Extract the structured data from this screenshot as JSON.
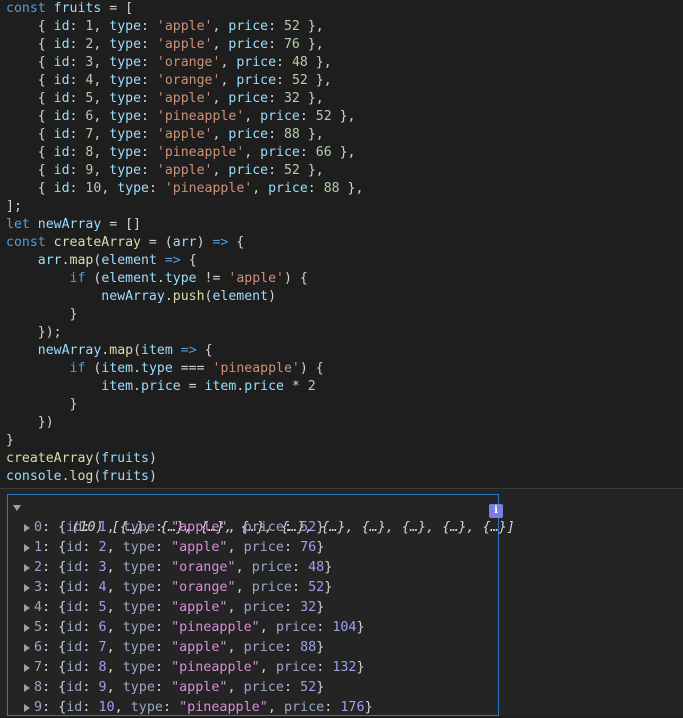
{
  "code": [
    [
      [
        "kw",
        "const "
      ],
      [
        "vr",
        "fruits"
      ],
      [
        "pl",
        " = ["
      ]
    ],
    [
      [
        "pl",
        "    { "
      ],
      [
        "vr",
        "id"
      ],
      [
        "pl",
        ": "
      ],
      [
        "nm",
        "1"
      ],
      [
        "pl",
        ", "
      ],
      [
        "vr",
        "type"
      ],
      [
        "pl",
        ": "
      ],
      [
        "st",
        "'apple'"
      ],
      [
        "pl",
        ", "
      ],
      [
        "vr",
        "price"
      ],
      [
        "pl",
        ": "
      ],
      [
        "nm",
        "52"
      ],
      [
        "pl",
        " },"
      ]
    ],
    [
      [
        "pl",
        "    { "
      ],
      [
        "vr",
        "id"
      ],
      [
        "pl",
        ": "
      ],
      [
        "nm",
        "2"
      ],
      [
        "pl",
        ", "
      ],
      [
        "vr",
        "type"
      ],
      [
        "pl",
        ": "
      ],
      [
        "st",
        "'apple'"
      ],
      [
        "pl",
        ", "
      ],
      [
        "vr",
        "price"
      ],
      [
        "pl",
        ": "
      ],
      [
        "nm",
        "76"
      ],
      [
        "pl",
        " },"
      ]
    ],
    [
      [
        "pl",
        "    { "
      ],
      [
        "vr",
        "id"
      ],
      [
        "pl",
        ": "
      ],
      [
        "nm",
        "3"
      ],
      [
        "pl",
        ", "
      ],
      [
        "vr",
        "type"
      ],
      [
        "pl",
        ": "
      ],
      [
        "st",
        "'orange'"
      ],
      [
        "pl",
        ", "
      ],
      [
        "vr",
        "price"
      ],
      [
        "pl",
        ": "
      ],
      [
        "nm",
        "48"
      ],
      [
        "pl",
        " },"
      ]
    ],
    [
      [
        "pl",
        "    { "
      ],
      [
        "vr",
        "id"
      ],
      [
        "pl",
        ": "
      ],
      [
        "nm",
        "4"
      ],
      [
        "pl",
        ", "
      ],
      [
        "vr",
        "type"
      ],
      [
        "pl",
        ": "
      ],
      [
        "st",
        "'orange'"
      ],
      [
        "pl",
        ", "
      ],
      [
        "vr",
        "price"
      ],
      [
        "pl",
        ": "
      ],
      [
        "nm",
        "52"
      ],
      [
        "pl",
        " },"
      ]
    ],
    [
      [
        "pl",
        "    { "
      ],
      [
        "vr",
        "id"
      ],
      [
        "pl",
        ": "
      ],
      [
        "nm",
        "5"
      ],
      [
        "pl",
        ", "
      ],
      [
        "vr",
        "type"
      ],
      [
        "pl",
        ": "
      ],
      [
        "st",
        "'apple'"
      ],
      [
        "pl",
        ", "
      ],
      [
        "vr",
        "price"
      ],
      [
        "pl",
        ": "
      ],
      [
        "nm",
        "32"
      ],
      [
        "pl",
        " },"
      ]
    ],
    [
      [
        "pl",
        "    { "
      ],
      [
        "vr",
        "id"
      ],
      [
        "pl",
        ": "
      ],
      [
        "nm",
        "6"
      ],
      [
        "pl",
        ", "
      ],
      [
        "vr",
        "type"
      ],
      [
        "pl",
        ": "
      ],
      [
        "st",
        "'pineapple'"
      ],
      [
        "pl",
        ", "
      ],
      [
        "vr",
        "price"
      ],
      [
        "pl",
        ": "
      ],
      [
        "nm",
        "52"
      ],
      [
        "pl",
        " },"
      ]
    ],
    [
      [
        "pl",
        "    { "
      ],
      [
        "vr",
        "id"
      ],
      [
        "pl",
        ": "
      ],
      [
        "nm",
        "7"
      ],
      [
        "pl",
        ", "
      ],
      [
        "vr",
        "type"
      ],
      [
        "pl",
        ": "
      ],
      [
        "st",
        "'apple'"
      ],
      [
        "pl",
        ", "
      ],
      [
        "vr",
        "price"
      ],
      [
        "pl",
        ": "
      ],
      [
        "nm",
        "88"
      ],
      [
        "pl",
        " },"
      ]
    ],
    [
      [
        "pl",
        "    { "
      ],
      [
        "vr",
        "id"
      ],
      [
        "pl",
        ": "
      ],
      [
        "nm",
        "8"
      ],
      [
        "pl",
        ", "
      ],
      [
        "vr",
        "type"
      ],
      [
        "pl",
        ": "
      ],
      [
        "st",
        "'pineapple'"
      ],
      [
        "pl",
        ", "
      ],
      [
        "vr",
        "price"
      ],
      [
        "pl",
        ": "
      ],
      [
        "nm",
        "66"
      ],
      [
        "pl",
        " },"
      ]
    ],
    [
      [
        "pl",
        "    { "
      ],
      [
        "vr",
        "id"
      ],
      [
        "pl",
        ": "
      ],
      [
        "nm",
        "9"
      ],
      [
        "pl",
        ", "
      ],
      [
        "vr",
        "type"
      ],
      [
        "pl",
        ": "
      ],
      [
        "st",
        "'apple'"
      ],
      [
        "pl",
        ", "
      ],
      [
        "vr",
        "price"
      ],
      [
        "pl",
        ": "
      ],
      [
        "nm",
        "52"
      ],
      [
        "pl",
        " },"
      ]
    ],
    [
      [
        "pl",
        "    { "
      ],
      [
        "vr",
        "id"
      ],
      [
        "pl",
        ": "
      ],
      [
        "nm",
        "10"
      ],
      [
        "pl",
        ", "
      ],
      [
        "vr",
        "type"
      ],
      [
        "pl",
        ": "
      ],
      [
        "st",
        "'pineapple'"
      ],
      [
        "pl",
        ", "
      ],
      [
        "vr",
        "price"
      ],
      [
        "pl",
        ": "
      ],
      [
        "nm",
        "88"
      ],
      [
        "pl",
        " },"
      ]
    ],
    [
      [
        "pl",
        "];"
      ]
    ],
    [
      [
        "kw",
        "let "
      ],
      [
        "vr",
        "newArray"
      ],
      [
        "pl",
        " = []"
      ]
    ],
    [
      [
        "kw",
        "const "
      ],
      [
        "fn",
        "createArray"
      ],
      [
        "pl",
        " = ("
      ],
      [
        "vr",
        "arr"
      ],
      [
        "pl",
        ") "
      ],
      [
        "kw",
        "=>"
      ],
      [
        "pl",
        " {"
      ]
    ],
    [
      [
        "pl",
        "    "
      ],
      [
        "vr",
        "arr"
      ],
      [
        "pl",
        "."
      ],
      [
        "fn",
        "map"
      ],
      [
        "pl",
        "("
      ],
      [
        "vr",
        "element"
      ],
      [
        "pl",
        " "
      ],
      [
        "kw",
        "=>"
      ],
      [
        "pl",
        " {"
      ]
    ],
    [
      [
        "pl",
        "        "
      ],
      [
        "kw",
        "if"
      ],
      [
        "pl",
        " ("
      ],
      [
        "vr",
        "element"
      ],
      [
        "pl",
        "."
      ],
      [
        "vr",
        "type"
      ],
      [
        "pl",
        " != "
      ],
      [
        "st",
        "'apple'"
      ],
      [
        "pl",
        ") {"
      ]
    ],
    [
      [
        "pl",
        "            "
      ],
      [
        "vr",
        "newArray"
      ],
      [
        "pl",
        "."
      ],
      [
        "fn",
        "push"
      ],
      [
        "pl",
        "("
      ],
      [
        "vr",
        "element"
      ],
      [
        "pl",
        ")"
      ]
    ],
    [
      [
        "pl",
        "        }"
      ]
    ],
    [
      [
        "pl",
        "    });"
      ]
    ],
    [
      [
        "pl",
        "    "
      ],
      [
        "vr",
        "newArray"
      ],
      [
        "pl",
        "."
      ],
      [
        "fn",
        "map"
      ],
      [
        "pl",
        "("
      ],
      [
        "vr",
        "item"
      ],
      [
        "pl",
        " "
      ],
      [
        "kw",
        "=>"
      ],
      [
        "pl",
        " {"
      ]
    ],
    [
      [
        "pl",
        "        "
      ],
      [
        "kw",
        "if"
      ],
      [
        "pl",
        " ("
      ],
      [
        "vr",
        "item"
      ],
      [
        "pl",
        "."
      ],
      [
        "vr",
        "type"
      ],
      [
        "pl",
        " === "
      ],
      [
        "st",
        "'pineapple'"
      ],
      [
        "pl",
        ") {"
      ]
    ],
    [
      [
        "pl",
        "            "
      ],
      [
        "vr",
        "item"
      ],
      [
        "pl",
        "."
      ],
      [
        "vr",
        "price"
      ],
      [
        "pl",
        " = "
      ],
      [
        "vr",
        "item"
      ],
      [
        "pl",
        "."
      ],
      [
        "vr",
        "price"
      ],
      [
        "pl",
        " * "
      ],
      [
        "nm",
        "2"
      ]
    ],
    [
      [
        "pl",
        "        }"
      ]
    ],
    [
      [
        "pl",
        "    })"
      ]
    ],
    [
      [
        "pl",
        "}"
      ]
    ],
    [
      [
        "fn",
        "createArray"
      ],
      [
        "pl",
        "("
      ],
      [
        "vr",
        "fruits"
      ],
      [
        "pl",
        ")"
      ]
    ],
    [
      [
        "vr",
        "console"
      ],
      [
        "pl",
        "."
      ],
      [
        "fn",
        "log"
      ],
      [
        "pl",
        "("
      ],
      [
        "vr",
        "fruits"
      ],
      [
        "pl",
        ")"
      ]
    ]
  ],
  "console": {
    "summary": "(10) [{…}, {…}, {…}, {…}, {…}, {…}, {…}, {…}, {…}, {…}]",
    "info_badge": "i",
    "entries": [
      {
        "index": "0",
        "id": "1",
        "type": "\"apple\"",
        "price": "52"
      },
      {
        "index": "1",
        "id": "2",
        "type": "\"apple\"",
        "price": "76"
      },
      {
        "index": "2",
        "id": "3",
        "type": "\"orange\"",
        "price": "48"
      },
      {
        "index": "3",
        "id": "4",
        "type": "\"orange\"",
        "price": "52"
      },
      {
        "index": "4",
        "id": "5",
        "type": "\"apple\"",
        "price": "32"
      },
      {
        "index": "5",
        "id": "6",
        "type": "\"pineapple\"",
        "price": "104"
      },
      {
        "index": "6",
        "id": "7",
        "type": "\"apple\"",
        "price": "88"
      },
      {
        "index": "7",
        "id": "8",
        "type": "\"pineapple\"",
        "price": "132"
      },
      {
        "index": "8",
        "id": "9",
        "type": "\"apple\"",
        "price": "52"
      },
      {
        "index": "9",
        "id": "10",
        "type": "\"pineapple\"",
        "price": "176"
      }
    ],
    "labels": {
      "id": "id",
      "type": "type",
      "price": "price"
    }
  },
  "colors": {
    "editor_bg": "#1e1e1e",
    "console_bg": "#242424",
    "keyword": "#569cd6",
    "variable": "#9cdcfe",
    "function": "#dcdcaa",
    "string": "#ce9178",
    "number": "#b5cea8",
    "focus_border": "#2f78c4"
  }
}
